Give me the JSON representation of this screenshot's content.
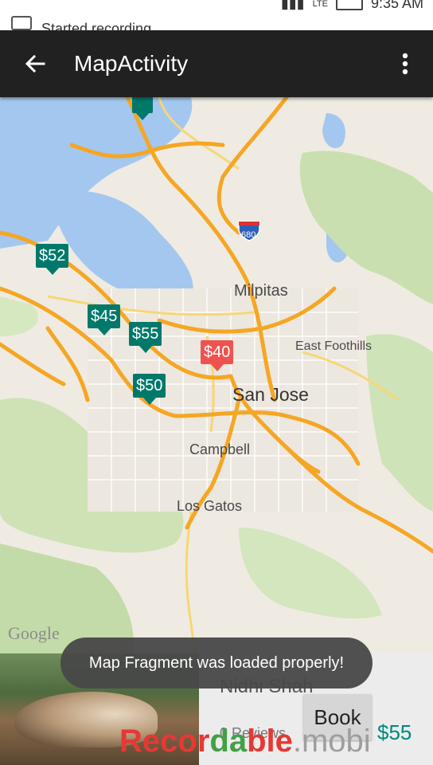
{
  "status_bar": {
    "notification_text": "Started recording",
    "time": "9:35 AM",
    "network": "LTE"
  },
  "toolbar": {
    "title": "MapActivity",
    "back_icon": "arrow-back-icon",
    "menu_icon": "more-vert-icon"
  },
  "map": {
    "places": {
      "milpitas": "Milpitas",
      "east_foothills": "East Foothills",
      "san_jose": "San Jose",
      "campbell": "Campbell",
      "los_gatos": "Los Gatos"
    },
    "highway_shield": "680",
    "attribution": "Google",
    "markers": [
      {
        "label": "$52",
        "color": "#00796b",
        "selected": false
      },
      {
        "label": "$45",
        "color": "#00796b",
        "selected": false
      },
      {
        "label": "$55",
        "color": "#00796b",
        "selected": false
      },
      {
        "label": "$40",
        "color": "#ef5350",
        "selected": true
      },
      {
        "label": "$50",
        "color": "#00796b",
        "selected": false
      }
    ]
  },
  "card": {
    "name": "Nidhi Shah",
    "reviews": "0 Reviews",
    "book_label": "Book",
    "price": "$55"
  },
  "toast": {
    "message": "Map Fragment was loaded properly!"
  },
  "watermark": {
    "part1": "Recor",
    "part2": "da",
    "part3": "ble",
    "part4": ".mobi"
  },
  "colors": {
    "accent_teal": "#00796b",
    "marker_red": "#ef5350",
    "toolbar_bg": "#212121",
    "highway": "#f5a623"
  }
}
